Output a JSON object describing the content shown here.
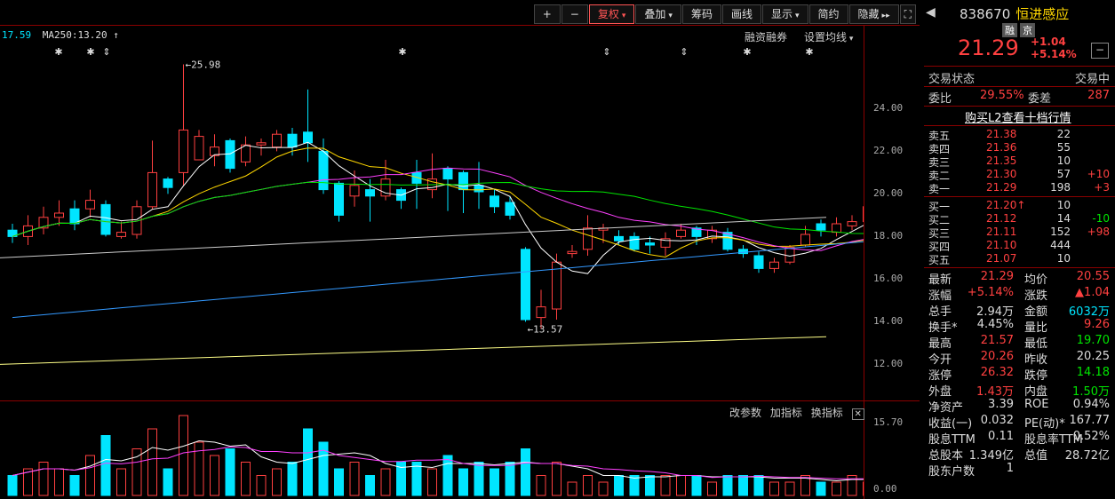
{
  "toolbar": {
    "items": [
      "+",
      "−",
      "复权",
      "叠加",
      "筹码",
      "画线",
      "显示",
      "简约",
      "隐藏"
    ],
    "expand_icon": "fullscreen-icon"
  },
  "legend": {
    "ma_prefix": "17.59",
    "ma250": "MA250:13.20"
  },
  "top_links": {
    "margin": "融资融券",
    "settings": "设置均线"
  },
  "annotations": {
    "high": "25.98",
    "low": "13.57"
  },
  "y_axis": [
    "24.00",
    "22.00",
    "20.00",
    "18.00",
    "16.00",
    "14.00",
    "12.00"
  ],
  "vol_axis": [
    "15.70",
    "0.00"
  ],
  "indicator_links": [
    "改参数",
    "加指标",
    "换指标"
  ],
  "panel": {
    "code": "838670",
    "name": "恒进感应",
    "tags": [
      "融",
      "京"
    ],
    "price": "21.29",
    "change": "+1.04",
    "change_pct": "+5.14%",
    "status_label": "交易状态",
    "status_value": "交易中",
    "ratio_label": "委比",
    "ratio_value": "29.55%",
    "diff_label": "委差",
    "diff_value": "287",
    "l2_link": "购买L2查看十档行情",
    "asks": [
      {
        "label": "卖五",
        "price": "21.38",
        "vol": "22",
        "chg": ""
      },
      {
        "label": "卖四",
        "price": "21.36",
        "vol": "55",
        "chg": ""
      },
      {
        "label": "卖三",
        "price": "21.35",
        "vol": "10",
        "chg": ""
      },
      {
        "label": "卖二",
        "price": "21.30",
        "vol": "57",
        "chg": "+10"
      },
      {
        "label": "卖一",
        "price": "21.29",
        "vol": "198",
        "chg": "+3"
      }
    ],
    "bids": [
      {
        "label": "买一",
        "price": "21.20↑",
        "vol": "10",
        "chg": ""
      },
      {
        "label": "买二",
        "price": "21.12",
        "vol": "14",
        "chg": "-10"
      },
      {
        "label": "买三",
        "price": "21.11",
        "vol": "152",
        "chg": "+98"
      },
      {
        "label": "买四",
        "price": "21.10",
        "vol": "444",
        "chg": ""
      },
      {
        "label": "买五",
        "price": "21.07",
        "vol": "10",
        "chg": ""
      }
    ],
    "stats": [
      {
        "l1": "最新",
        "v1": "21.29",
        "c1": "red",
        "l2": "均价",
        "v2": "20.55",
        "c2": "red"
      },
      {
        "l1": "涨幅",
        "v1": "+5.14%",
        "c1": "red",
        "l2": "涨跌",
        "v2": "▲1.04",
        "c2": "red"
      },
      {
        "l1": "总手",
        "v1": "2.94万",
        "c1": "white",
        "l2": "金额",
        "v2": "6032万",
        "c2": "cyan"
      },
      {
        "l1": "换手*",
        "v1": "4.45%",
        "c1": "white",
        "l2": "量比",
        "v2": "9.26",
        "c2": "red"
      },
      {
        "l1": "最高",
        "v1": "21.57",
        "c1": "red",
        "l2": "最低",
        "v2": "19.70",
        "c2": "green"
      },
      {
        "l1": "今开",
        "v1": "20.26",
        "c1": "red",
        "l2": "昨收",
        "v2": "20.25",
        "c2": "white"
      },
      {
        "l1": "涨停",
        "v1": "26.32",
        "c1": "red",
        "l2": "跌停",
        "v2": "14.18",
        "c2": "green"
      },
      {
        "l1": "外盘",
        "v1": "1.43万",
        "c1": "red",
        "l2": "内盘",
        "v2": "1.50万",
        "c2": "green"
      },
      {
        "l1": "净资产",
        "v1": "3.39",
        "c1": "white",
        "l2": "ROE",
        "v2": "0.94%",
        "c2": "white"
      },
      {
        "l1": "收益(一)",
        "v1": "0.032",
        "c1": "white",
        "l2": "PE(动)*",
        "v2": "167.77",
        "c2": "white"
      },
      {
        "l1": "股息TTM",
        "v1": "0.11",
        "c1": "white",
        "l2": "股息率TTM",
        "v2": "0.52%",
        "c2": "white"
      },
      {
        "l1": "总股本",
        "v1": "1.349亿",
        "c1": "white",
        "l2": "总值",
        "v2": "28.72亿",
        "c2": "white"
      },
      {
        "l1": "股东户数",
        "v1": "1",
        "c1": "white",
        "l2": "",
        "v2": "",
        "c2": "white"
      }
    ]
  },
  "colors": {
    "up": "#ff4040",
    "down": "#00e5ff",
    "ma5": "#ffffff",
    "ma10": "#ffd700",
    "ma20": "#ff40ff",
    "ma30": "#00e600",
    "ma60": "#3399ff",
    "ma250": "#ffff88"
  }
}
